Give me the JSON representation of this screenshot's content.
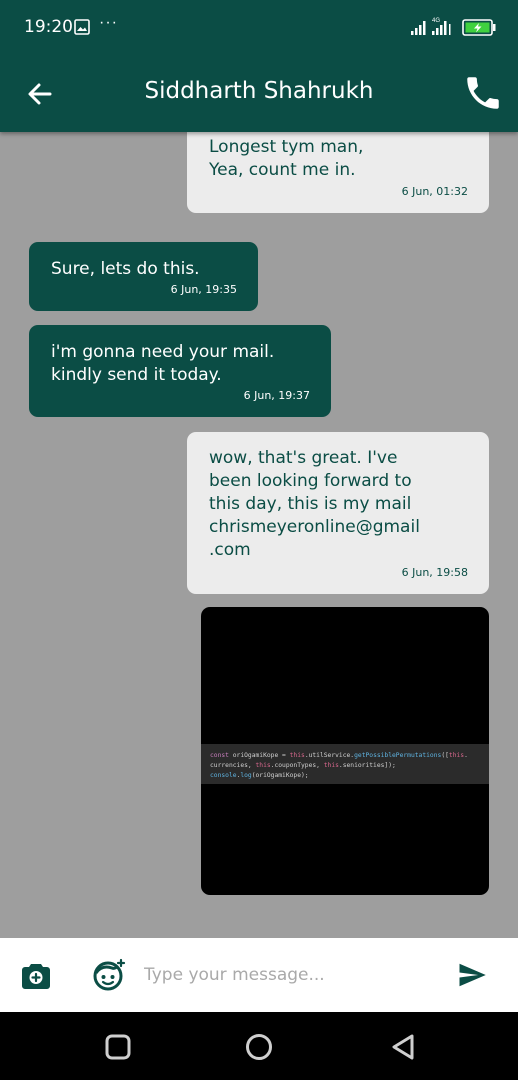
{
  "status_bar": {
    "time": "19:20",
    "more": "···",
    "network_label": "4G",
    "icons": [
      "gallery-icon",
      "signal-icon",
      "battery-charging-icon"
    ]
  },
  "header": {
    "contact_name": "Siddharth Shahrukh",
    "icons": [
      "arrow-back-icon",
      "phone-icon"
    ]
  },
  "messages": [
    {
      "direction": "outgoing",
      "text": "Longest tym man,\nYea, count me in.",
      "time": "6 Jun, 01:32"
    },
    {
      "direction": "incoming",
      "text": "Sure, lets do this.",
      "time": "6 Jun, 19:35"
    },
    {
      "direction": "incoming",
      "text": "i'm gonna need your mail.\nkindly send it today.",
      "time": "6 Jun, 19:37"
    },
    {
      "direction": "outgoing",
      "text": "wow, that's great. I've\nbeen looking forward to\nthis day, this is my mail\nchrismeyeronline@gmail\n.com",
      "time": "6 Jun, 19:58"
    },
    {
      "direction": "outgoing",
      "type": "image",
      "code_lines": [
        "const oriOgamiKope = this.utilService.getPossiblePermutations([this.",
        "currencies, this.couponTypes, this.seniorities]);",
        "console.log(oriOgamiKope);"
      ]
    }
  ],
  "composer": {
    "placeholder": "Type your message...",
    "value": "",
    "icons": [
      "camera-add-icon",
      "emoji-icon",
      "send-icon"
    ]
  },
  "nav_bar": {
    "icons": [
      "recents-square-icon",
      "home-circle-icon",
      "back-triangle-icon"
    ]
  },
  "colors": {
    "primary": "#0b4d45",
    "chat_background": "#9e9e9e",
    "outgoing_bubble": "#ececec",
    "incoming_bubble": "#0b4d45"
  }
}
